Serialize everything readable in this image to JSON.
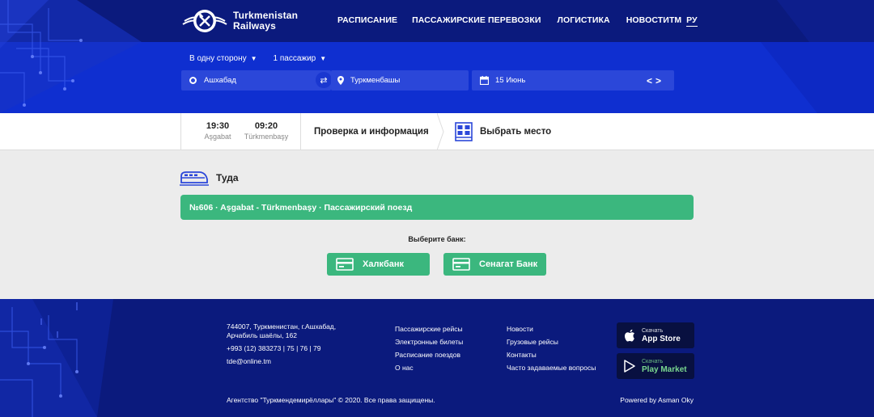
{
  "header": {
    "logo_line1": "Turkmenistan",
    "logo_line2": "Railways",
    "nav": [
      "РАСПИСАНИЕ",
      "ПАССАЖИРСКИЕ ПЕРЕВОЗКИ",
      "ЛОГИСТИКА",
      "НОВОСТИ"
    ],
    "langs": [
      "ТМ",
      "РУ"
    ],
    "active_lang": "РУ"
  },
  "search": {
    "trip_type": "В одну сторону",
    "passengers": "1 пассажир",
    "from": "Ашхабад",
    "to": "Туркменбашы",
    "date": "15 Июнь",
    "date_prev": "<",
    "date_next": ">"
  },
  "steps": {
    "depart_time": "19:30",
    "depart_city": "Aşgabat",
    "arrive_time": "09:20",
    "arrive_city": "Türkmenbaşy",
    "check": "Проверка и информация",
    "seat": "Выбрать место"
  },
  "main": {
    "direction": "Туда",
    "train": "№606 · Aşgabat - Türkmenbaşy · Пассажирский поезд",
    "bank_prompt": "Выберите банк:",
    "banks": [
      "Халкбанк",
      "Сенагат Банк"
    ]
  },
  "footer": {
    "address_line1": "744007, Туркменистан, г.Ашхабад,",
    "address_line2": "Арчабиль шаёлы, 162",
    "phone": "+993 (12) 383273 | 75 | 76 | 79",
    "email": "tde@online.tm",
    "links1": [
      "Пассажирские рейсы",
      "Электронные билеты",
      "Расписание поездов",
      "О нас"
    ],
    "links2": [
      "Новости",
      "Грузовые рейсы",
      "Контакты",
      "Часто задаваемые вопросы"
    ],
    "appstore_small": "Скачать",
    "appstore_big": "App Store",
    "play_small": "Скачать",
    "play_big": "Play Market",
    "copyright": "Агентство \"Туркмендемирёллары\" © 2020. Все права защищены.",
    "powered": "Powered by Asman Oky"
  },
  "colors": {
    "header_blue": "#0f2fd0",
    "dark_navy": "#0b1a7d",
    "green": "#3bb77e",
    "field_blue": "#2b47d9"
  }
}
